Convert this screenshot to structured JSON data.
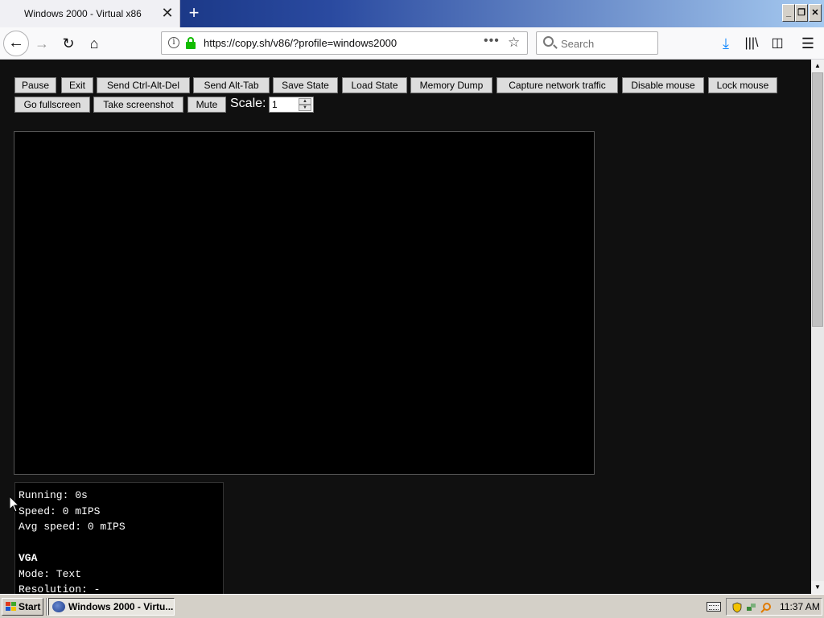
{
  "browser": {
    "tab_title": "Windows 2000 - Virtual x86",
    "url": "https://copy.sh/v86/?profile=windows2000",
    "search_placeholder": "Search"
  },
  "controls": {
    "buttons": [
      "Pause",
      "Exit",
      "Send Ctrl-Alt-Del",
      "Send Alt-Tab",
      "Save State",
      "Load State",
      "Memory Dump",
      "Capture network traffic",
      "Disable mouse",
      "Lock mouse",
      "Go fullscreen",
      "Take screenshot",
      "Mute"
    ],
    "scale_label": "Scale:",
    "scale_value": "1"
  },
  "info": {
    "running": "Running: 0s",
    "speed": "Speed: 0 mIPS",
    "avg_speed": "Avg speed: 0 mIPS",
    "vga_heading": "VGA",
    "mode": "Mode: Text",
    "resolution": "Resolution: -"
  },
  "taskbar": {
    "start_label": "Start",
    "task_label": "Windows 2000 - Virtu...",
    "clock": "11:37 AM"
  },
  "colors": {
    "page_background": "#101010",
    "vm_screen": "#000000",
    "lock_green": "#12bc00",
    "download_blue": "#0a84ff"
  }
}
